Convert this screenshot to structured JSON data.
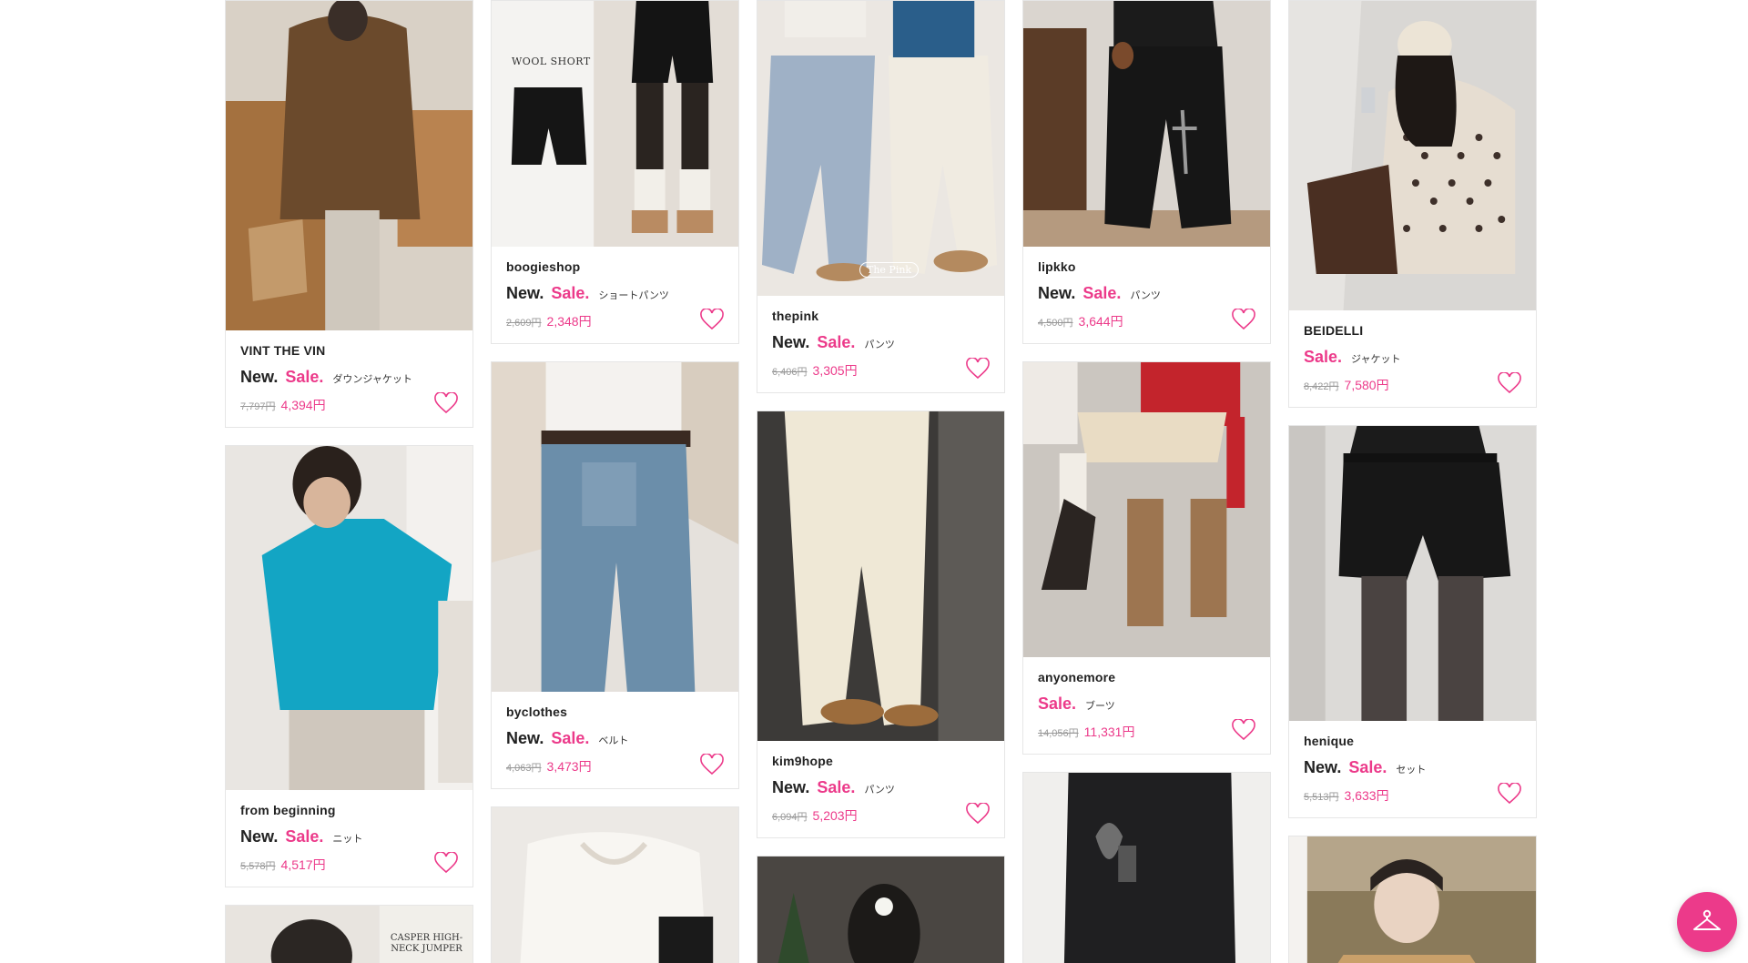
{
  "accent_color": "#ec3a8a",
  "products": [
    {
      "shop": "VINT THE VIN",
      "new_tag": "New.",
      "sale_tag": "Sale.",
      "category": "ダウンジャケット",
      "old_price": "7,797円",
      "price": "4,394円"
    },
    {
      "shop": "from beginning",
      "new_tag": "New.",
      "sale_tag": "Sale.",
      "category": "ニット",
      "old_price": "5,578円",
      "price": "4,517円"
    },
    {
      "shop": "boogieshop",
      "new_tag": "New.",
      "sale_tag": "Sale.",
      "category": "ショートパンツ",
      "old_price": "2,609円",
      "price": "2,348円",
      "image_text": "WOOL SHORT"
    },
    {
      "shop": "byclothes",
      "new_tag": "New.",
      "sale_tag": "Sale.",
      "category": "ベルト",
      "old_price": "4,063円",
      "price": "3,473円"
    },
    {
      "shop": "thepink",
      "new_tag": "New.",
      "sale_tag": "Sale.",
      "category": "パンツ",
      "old_price": "6,406円",
      "price": "3,305円",
      "image_text": "The Pink"
    },
    {
      "shop": "kim9hope",
      "new_tag": "New.",
      "sale_tag": "Sale.",
      "category": "パンツ",
      "old_price": "6,094円",
      "price": "5,203円"
    },
    {
      "shop": "lipkko",
      "new_tag": "New.",
      "sale_tag": "Sale.",
      "category": "パンツ",
      "old_price": "4,500円",
      "price": "3,644円"
    },
    {
      "shop": "anyonemore",
      "new_tag": "",
      "sale_tag": "Sale.",
      "category": "ブーツ",
      "old_price": "14,056円",
      "price": "11,331円"
    },
    {
      "shop": "BEIDELLI",
      "new_tag": "",
      "sale_tag": "Sale.",
      "category": "ジャケット",
      "old_price": "8,422円",
      "price": "7,580円"
    },
    {
      "shop": "henique",
      "new_tag": "New.",
      "sale_tag": "Sale.",
      "category": "セット",
      "old_price": "5,513円",
      "price": "3,633円"
    }
  ],
  "partial_image_text": {
    "casper": "CASPER HIGH-NECK JUMPER"
  },
  "fab_icon": "hanger-icon"
}
